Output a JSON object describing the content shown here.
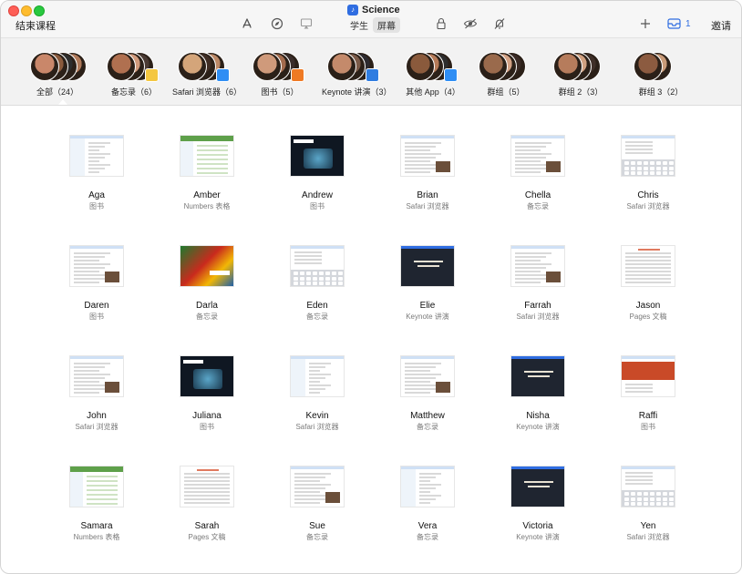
{
  "window": {
    "end_class": "结束课程",
    "title": "Science",
    "seg_students": "学生",
    "seg_screens": "屏幕",
    "inbox_count": "1",
    "invite": "邀请"
  },
  "groups": [
    {
      "label": "全部（24）",
      "avatars": [
        "#c9876a",
        "#8a5a3c",
        "#2d2d2d",
        "#b07a5a"
      ],
      "badge_color": ""
    },
    {
      "label": "备忘录（6）",
      "avatars": [
        "#b07050",
        "#d09a7c",
        "#4a3a33"
      ],
      "badge_color": "#f4c741"
    },
    {
      "label": "Safari 浏览器（6）",
      "avatars": [
        "#d4a57a",
        "#3f2d24",
        "#bb8866"
      ],
      "badge_color": "#2f8ef4"
    },
    {
      "label": "图书（5）",
      "avatars": [
        "#cf9a7b",
        "#a36b4d",
        "#3a2d2a"
      ],
      "badge_color": "#ef7a24"
    },
    {
      "label": "Keynote 讲演（3）",
      "avatars": [
        "#c48a6b",
        "#7b5b49",
        "#2d2b30"
      ],
      "badge_color": "#2f7de1"
    },
    {
      "label": "其他 App（4）",
      "avatars": [
        "#8a5a3c",
        "#b57a58",
        "#2d2d2d"
      ],
      "badge_color": "#2f8ef4"
    },
    {
      "label": "群组（5）",
      "avatars": [
        "#9a6a4c",
        "#d2a184",
        "#3a2a25"
      ],
      "badge_color": ""
    },
    {
      "label": "群组 2（3）",
      "avatars": [
        "#b67c5c",
        "#d0a080",
        "#3f2f28"
      ],
      "badge_color": ""
    },
    {
      "label": "群组 3（2）",
      "avatars": [
        "#8c5b40",
        "#c89a78"
      ],
      "badge_color": ""
    }
  ],
  "students": [
    {
      "name": "Aga",
      "app": "图书",
      "thumb": "doc-side"
    },
    {
      "name": "Amber",
      "app": "Numbers 表格",
      "thumb": "green"
    },
    {
      "name": "Andrew",
      "app": "图书",
      "thumb": "bio"
    },
    {
      "name": "Brian",
      "app": "Safari 浏览器",
      "thumb": "doc"
    },
    {
      "name": "Chella",
      "app": "备忘录",
      "thumb": "doc"
    },
    {
      "name": "Chris",
      "app": "Safari 浏览器",
      "thumb": "kbd"
    },
    {
      "name": "Daren",
      "app": "图书",
      "thumb": "doc"
    },
    {
      "name": "Darla",
      "app": "备忘录",
      "thumb": "parrot"
    },
    {
      "name": "Eden",
      "app": "备忘录",
      "thumb": "kbd"
    },
    {
      "name": "Elie",
      "app": "Keynote 讲演",
      "thumb": "dark"
    },
    {
      "name": "Farrah",
      "app": "Safari 浏览器",
      "thumb": "doc"
    },
    {
      "name": "Jason",
      "app": "Pages 文稿",
      "thumb": "page"
    },
    {
      "name": "John",
      "app": "Safari 浏览器",
      "thumb": "doc"
    },
    {
      "name": "Juliana",
      "app": "图书",
      "thumb": "bio"
    },
    {
      "name": "Kevin",
      "app": "Safari 浏览器",
      "thumb": "doc-side"
    },
    {
      "name": "Matthew",
      "app": "备忘录",
      "thumb": "doc"
    },
    {
      "name": "Nisha",
      "app": "Keynote 讲演",
      "thumb": "dark"
    },
    {
      "name": "Raffi",
      "app": "图书",
      "thumb": "red"
    },
    {
      "name": "Samara",
      "app": "Numbers 表格",
      "thumb": "green"
    },
    {
      "name": "Sarah",
      "app": "Pages 文稿",
      "thumb": "page"
    },
    {
      "name": "Sue",
      "app": "备忘录",
      "thumb": "doc"
    },
    {
      "name": "Vera",
      "app": "备忘录",
      "thumb": "doc-side"
    },
    {
      "name": "Victoria",
      "app": "Keynote 讲演",
      "thumb": "dark"
    },
    {
      "name": "Yen",
      "app": "Safari 浏览器",
      "thumb": "kbd"
    }
  ]
}
